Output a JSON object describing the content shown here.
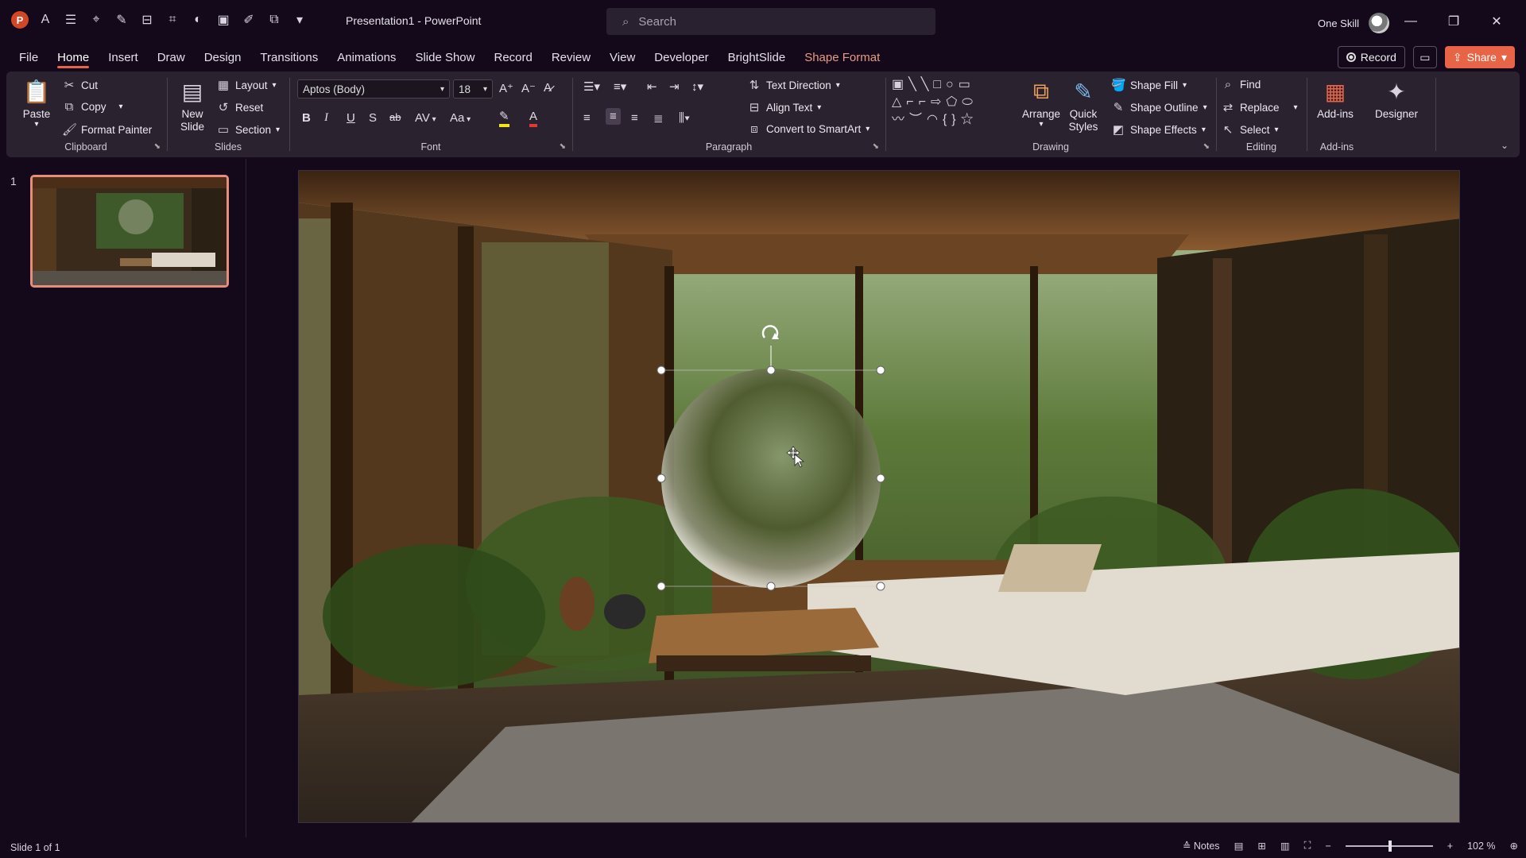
{
  "app": {
    "title": "Presentation1  -  PowerPoint"
  },
  "search": {
    "placeholder": "Search"
  },
  "user": {
    "name": "One Skill"
  },
  "tabs": [
    "File",
    "Home",
    "Insert",
    "Draw",
    "Design",
    "Transitions",
    "Animations",
    "Slide Show",
    "Record",
    "Review",
    "View",
    "Developer",
    "BrightSlide",
    "Shape Format"
  ],
  "active_tab": "Home",
  "tab_right": {
    "record": "Record",
    "share": "Share"
  },
  "ribbon": {
    "clipboard": {
      "label": "Clipboard",
      "paste": "Paste",
      "cut": "Cut",
      "copy": "Copy",
      "format_painter": "Format Painter"
    },
    "slides": {
      "label": "Slides",
      "new_slide": "New Slide",
      "layout": "Layout",
      "reset": "Reset",
      "section": "Section"
    },
    "font": {
      "label": "Font",
      "font_name": "Aptos (Body)",
      "font_size": "18",
      "bold": "B",
      "italic": "I",
      "underline": "U",
      "shadow": "S",
      "strike": "ab",
      "spacing": "AV",
      "case": "Aa"
    },
    "paragraph": {
      "label": "Paragraph",
      "text_direction": "Text Direction",
      "align_text": "Align Text",
      "smartart": "Convert to SmartArt"
    },
    "drawing": {
      "label": "Drawing",
      "arrange": "Arrange",
      "quick_styles": "Quick Styles",
      "shape_fill": "Shape Fill",
      "shape_outline": "Shape Outline",
      "shape_effects": "Shape Effects"
    },
    "editing": {
      "label": "Editing",
      "find": "Find",
      "replace": "Replace",
      "select": "Select"
    },
    "addins": {
      "label": "Add-ins",
      "addins_btn": "Add-ins",
      "designer": "Designer"
    }
  },
  "thumbnail": {
    "number": "1"
  },
  "status": {
    "slide_info": "Slide 1 of 1",
    "notes": "Notes",
    "zoom": "102 %"
  },
  "colors": {
    "accent": "#e76446",
    "background": "#13091b",
    "ribbon": "#2b2230"
  }
}
